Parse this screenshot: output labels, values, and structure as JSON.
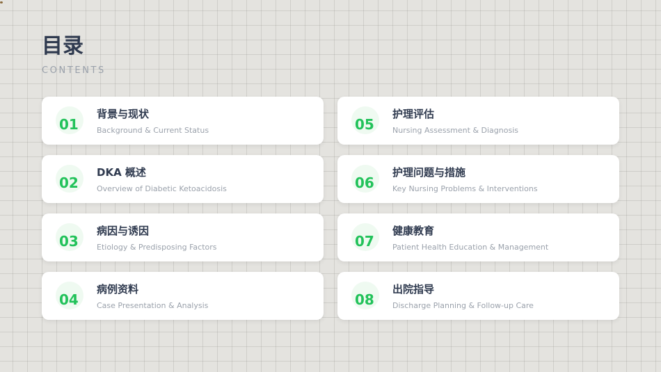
{
  "header": {
    "title": "目录",
    "subtitle": "CONTENTS"
  },
  "items": [
    {
      "num": "01",
      "title": "背景与现状",
      "subtitle": "Background & Current Status"
    },
    {
      "num": "02",
      "title": "DKA 概述",
      "subtitle": "Overview of Diabetic Ketoacidosis"
    },
    {
      "num": "03",
      "title": "病因与诱因",
      "subtitle": "Etiology & Predisposing Factors"
    },
    {
      "num": "04",
      "title": "病例资料",
      "subtitle": "Case Presentation & Analysis"
    },
    {
      "num": "05",
      "title": "护理评估",
      "subtitle": "Nursing Assessment & Diagnosis"
    },
    {
      "num": "06",
      "title": "护理问题与措施",
      "subtitle": "Key Nursing Problems & Interventions"
    },
    {
      "num": "07",
      "title": "健康教育",
      "subtitle": "Patient Health Education & Management"
    },
    {
      "num": "08",
      "title": "出院指导",
      "subtitle": "Discharge Planning & Follow-up Care"
    }
  ],
  "colors": {
    "accent": "#22c25a",
    "title": "#2f3a4f",
    "muted": "#9aa1ab"
  }
}
